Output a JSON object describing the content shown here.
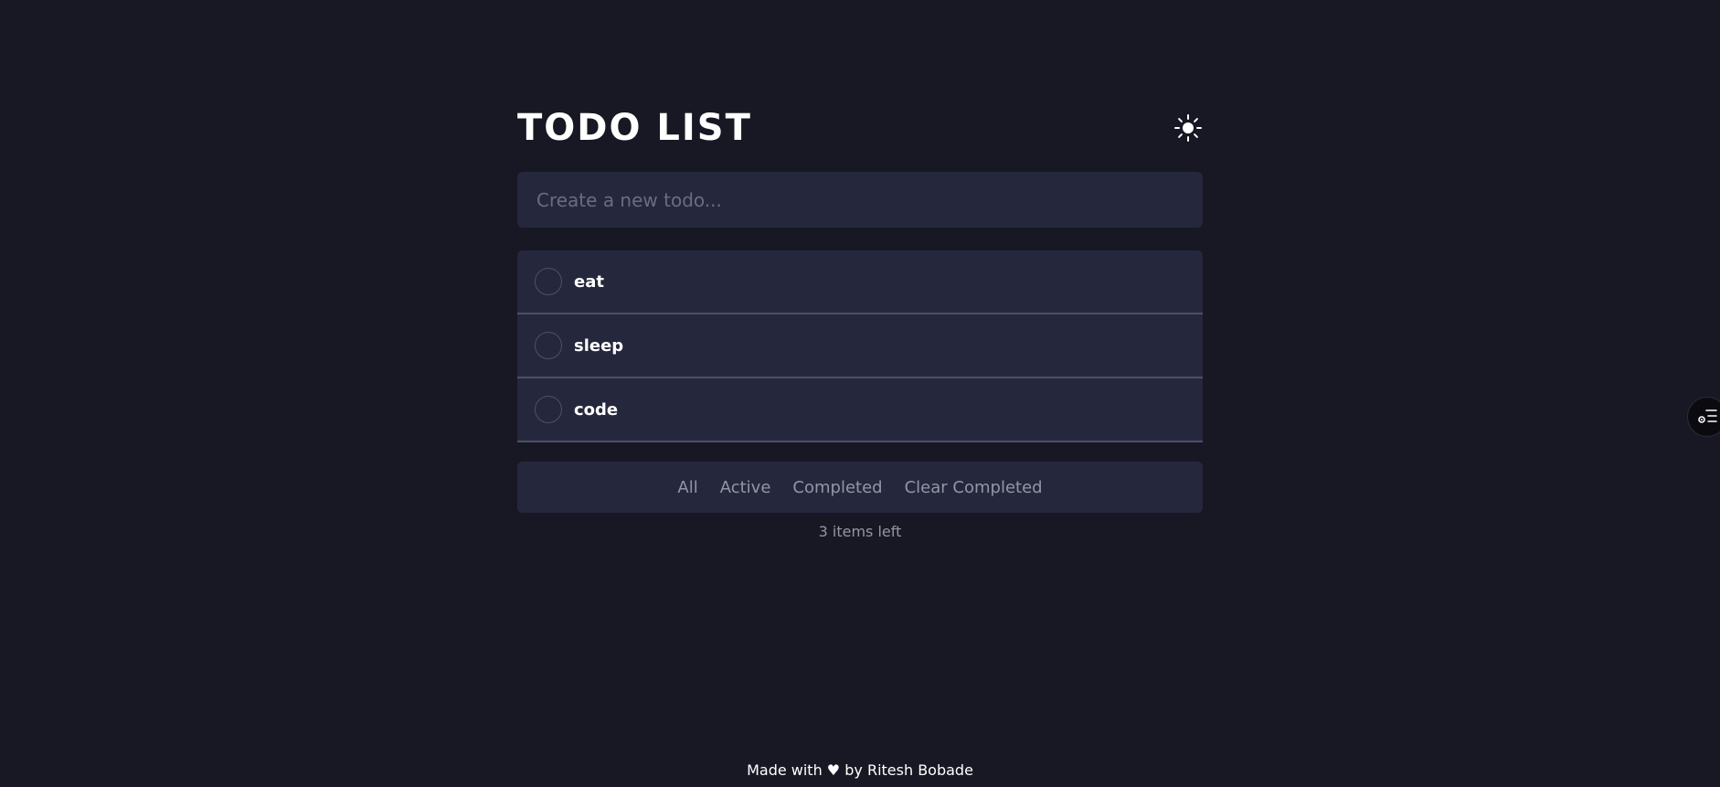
{
  "header": {
    "title": "TODO LIST",
    "theme_icon": "sun-icon"
  },
  "new_todo": {
    "placeholder": "Create a new todo..."
  },
  "todos": [
    {
      "text": "eat",
      "completed": false
    },
    {
      "text": "sleep",
      "completed": false
    },
    {
      "text": "code",
      "completed": false
    }
  ],
  "filters": {
    "all": "All",
    "active": "Active",
    "completed": "Completed",
    "clear_completed": "Clear Completed"
  },
  "items_left": "3 items left",
  "footer": {
    "text": "Made with ♥ by Ritesh Bobade"
  },
  "side_widget": {
    "icon": "settings-list-icon"
  },
  "colors": {
    "background": "#181824",
    "card": "#25273d",
    "divider": "#4d5067",
    "muted_text": "#9495a5",
    "placeholder": "#6b6c84",
    "text": "#ffffff"
  }
}
